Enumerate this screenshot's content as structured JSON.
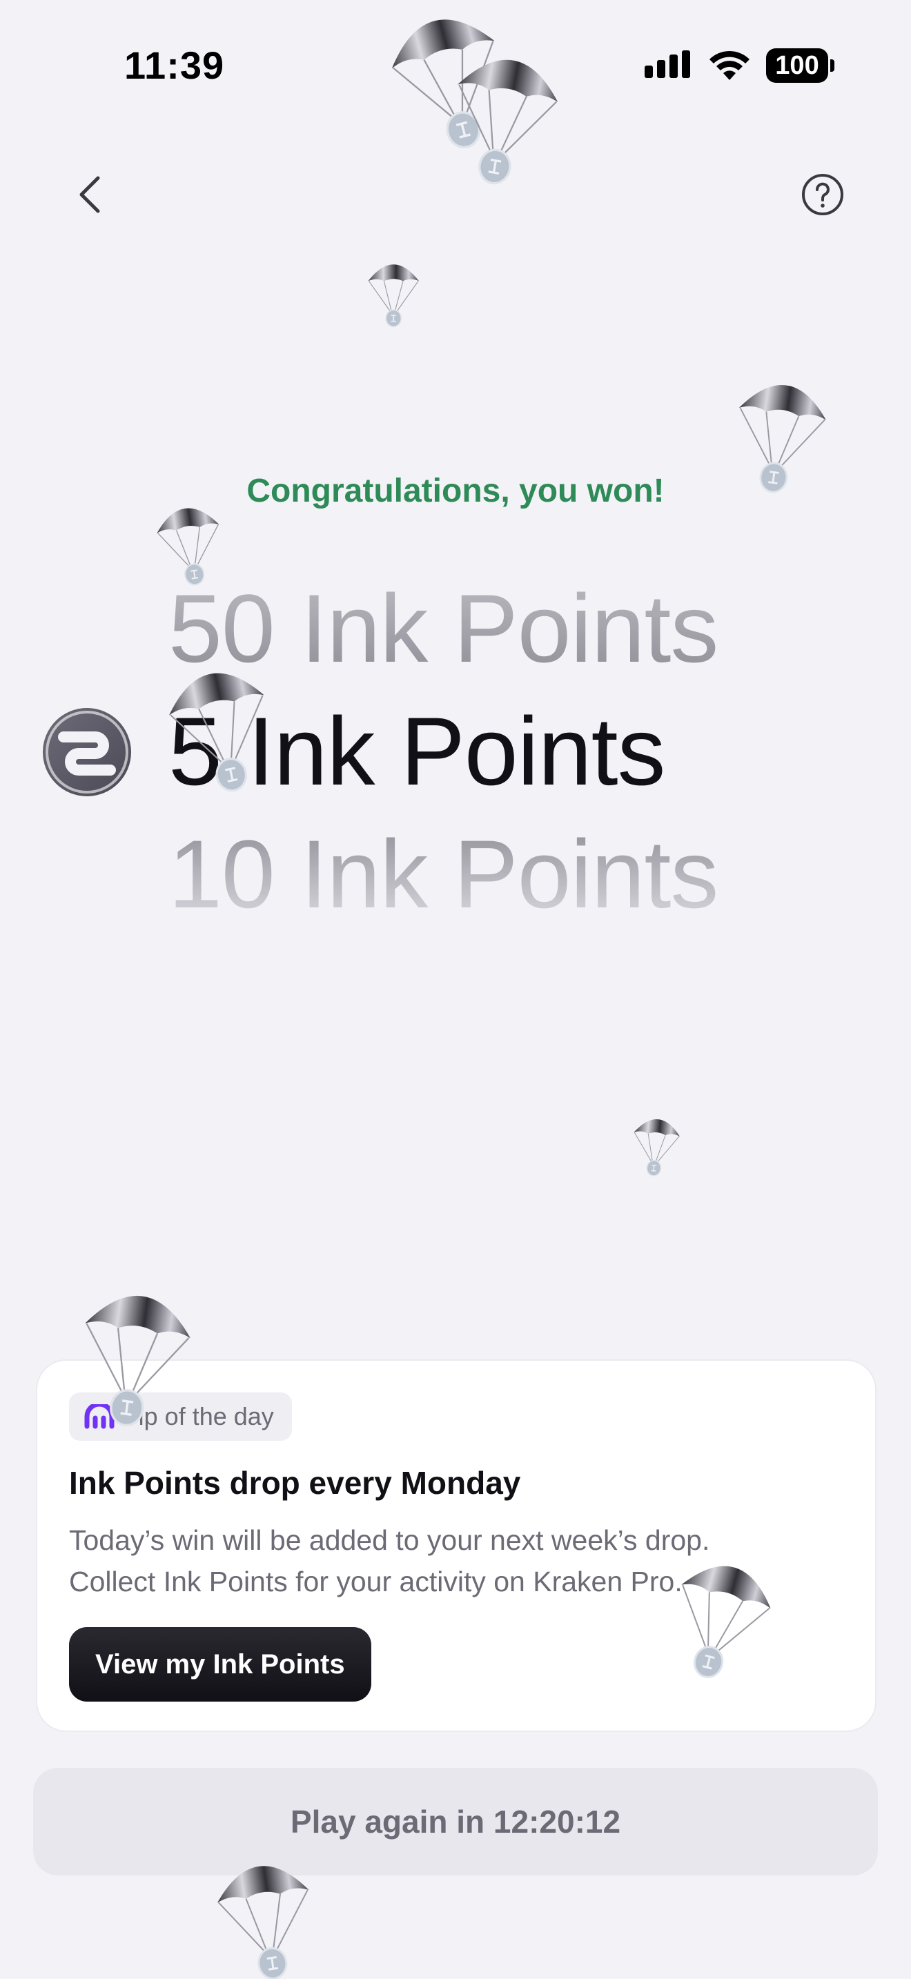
{
  "status_bar": {
    "time": "11:39",
    "battery": "100"
  },
  "nav": {
    "back_icon": "chevron-left-icon",
    "help_icon": "question-circle-icon"
  },
  "result": {
    "congrats": "Congratulations, you won!",
    "reel_above": "50 Ink Points",
    "reel_selected": "5 Ink Points",
    "reel_below": "10 Ink Points"
  },
  "tip": {
    "badge": "Tip of the day",
    "title": "Ink Points drop every Monday",
    "body_line1": "Today’s win will be added to your next week’s drop.",
    "body_line2": "Collect Ink Points for your activity on Kraken Pro.",
    "button": "View my Ink Points"
  },
  "play_again": "Play again in 12:20:12",
  "colors": {
    "accent_green": "#2e8b57",
    "brand_purple": "#7132f5",
    "background": "#f3f2f7"
  }
}
